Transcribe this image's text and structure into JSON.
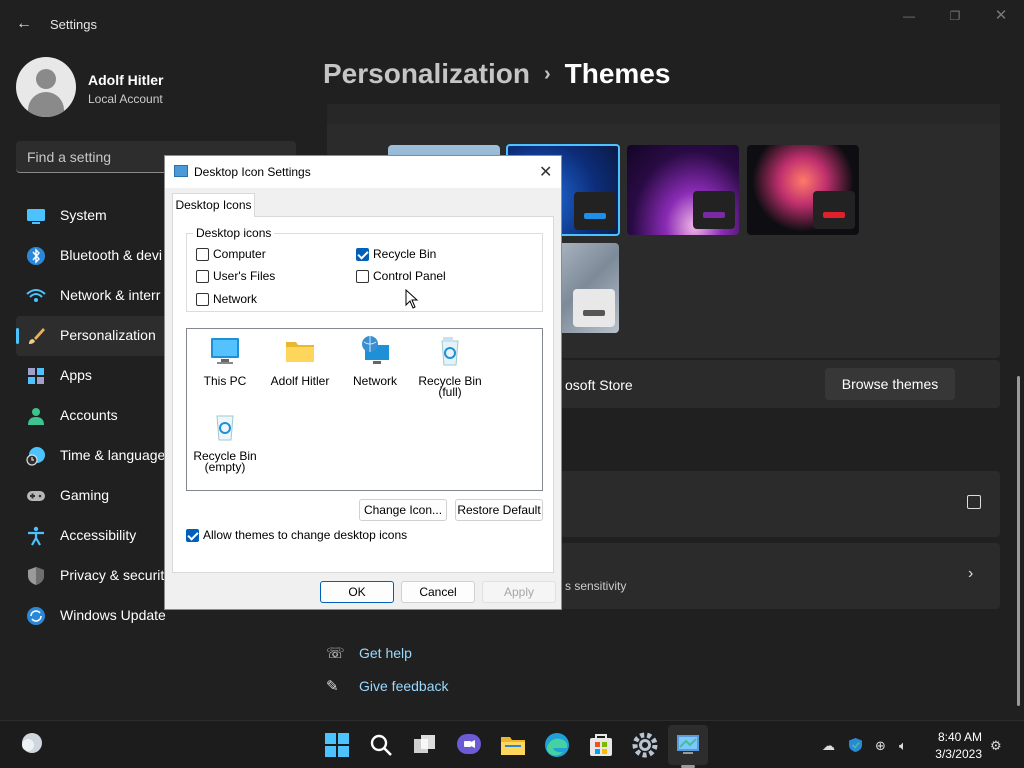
{
  "settings": {
    "app_title": "Settings",
    "user": {
      "name": "Adolf Hitler",
      "account_type": "Local Account"
    },
    "search_placeholder": "Find a setting",
    "nav": [
      {
        "label": "System",
        "icon": "monitor-icon"
      },
      {
        "label": "Bluetooth & devi",
        "icon": "bluetooth-icon"
      },
      {
        "label": "Network & interr",
        "icon": "wifi-icon"
      },
      {
        "label": "Personalization",
        "icon": "paintbrush-icon",
        "active": true
      },
      {
        "label": "Apps",
        "icon": "apps-icon"
      },
      {
        "label": "Accounts",
        "icon": "person-icon"
      },
      {
        "label": "Time & language",
        "icon": "clock-globe-icon"
      },
      {
        "label": "Gaming",
        "icon": "gamepad-icon"
      },
      {
        "label": "Accessibility",
        "icon": "accessibility-icon"
      },
      {
        "label": "Privacy & security",
        "icon": "shield-icon"
      },
      {
        "label": "Windows Update",
        "icon": "update-icon"
      }
    ],
    "breadcrumb": {
      "parent": "Personalization",
      "separator": "›",
      "current": "Themes"
    },
    "store_text": "osoft Store",
    "browse_themes": "Browse themes",
    "row_subtitle": "s sensitivity",
    "help": {
      "get_help": "Get help",
      "give_feedback": "Give feedback"
    },
    "accent_color": "#4cc2ff",
    "link_color": "#99d8ff"
  },
  "dialog": {
    "title": "Desktop Icon Settings",
    "tab": "Desktop Icons",
    "group_label": "Desktop icons",
    "checkboxes": {
      "computer": {
        "label": "Computer",
        "checked": false
      },
      "users_files": {
        "label": "User's Files",
        "checked": false
      },
      "network": {
        "label": "Network",
        "checked": false
      },
      "recycle_bin": {
        "label": "Recycle Bin",
        "checked": true
      },
      "control_panel": {
        "label": "Control Panel",
        "checked": false
      }
    },
    "icons": {
      "this_pc": {
        "label": "This PC",
        "icon": "monitor-icon"
      },
      "user_folder": {
        "label": "Adolf Hitler",
        "icon": "folder-icon"
      },
      "network": {
        "label": "Network",
        "icon": "network-globe-icon"
      },
      "recycle_full_1": "Recycle Bin",
      "recycle_full_2": "(full)",
      "recycle_empty_1": "Recycle Bin",
      "recycle_empty_2": "(empty)"
    },
    "change_icon": "Change Icon...",
    "restore_default": "Restore Default",
    "allow_themes": {
      "label": "Allow themes to change desktop icons",
      "checked": true
    },
    "ok": "OK",
    "cancel": "Cancel",
    "apply": "Apply"
  },
  "taskbar": {
    "apps": [
      "start-icon",
      "search-icon",
      "task-view-icon",
      "chat-icon",
      "file-explorer-icon",
      "edge-icon",
      "store-icon",
      "settings-icon",
      "control-panel-icon"
    ],
    "time": "8:40 AM",
    "date": "3/3/2023"
  }
}
